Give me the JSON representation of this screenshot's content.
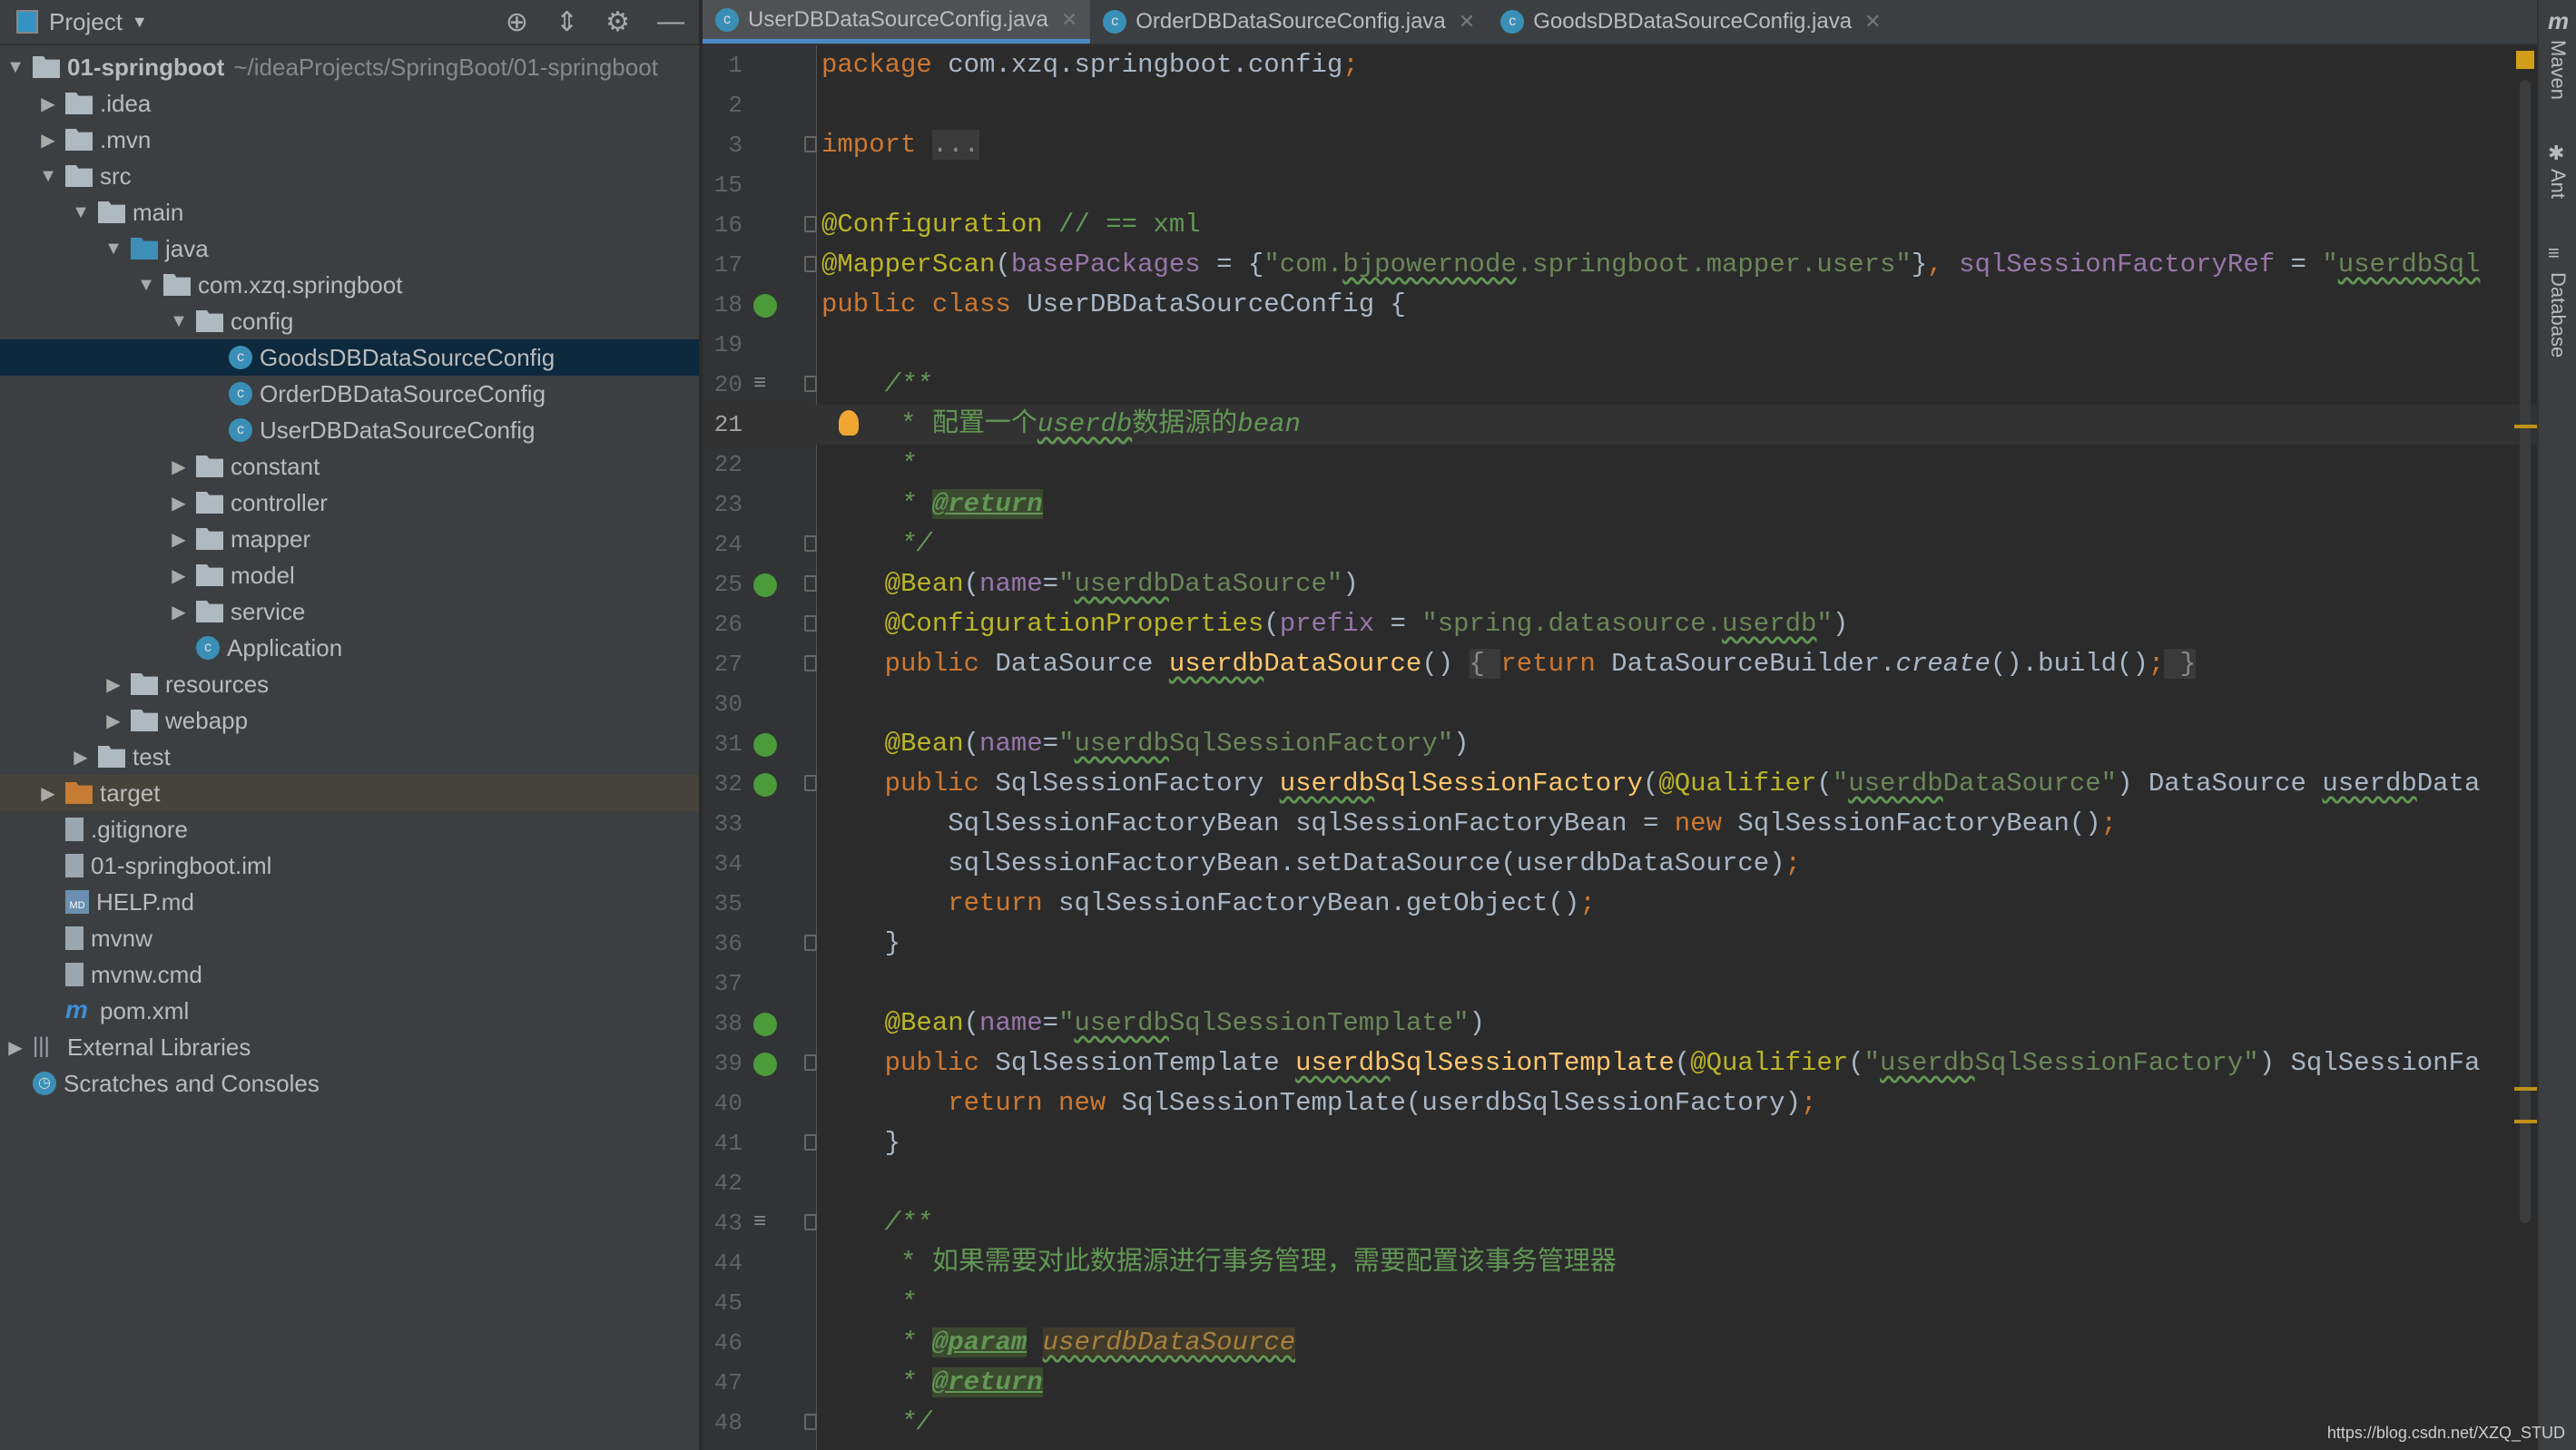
{
  "sidebar": {
    "title": "Project",
    "tree": [
      {
        "label": "01-springboot",
        "extra": "~/ideaProjects/SpringBoot/01-springboot",
        "depth": 0,
        "arrow": "down",
        "icon": "module-folder",
        "bold": true
      },
      {
        "label": ".idea",
        "depth": 1,
        "arrow": "right",
        "icon": "folder"
      },
      {
        "label": ".mvn",
        "depth": 1,
        "arrow": "right",
        "icon": "folder"
      },
      {
        "label": "src",
        "depth": 1,
        "arrow": "down",
        "icon": "folder"
      },
      {
        "label": "main",
        "depth": 2,
        "arrow": "down",
        "icon": "folder"
      },
      {
        "label": "java",
        "depth": 3,
        "arrow": "down",
        "icon": "source-folder"
      },
      {
        "label": "com.xzq.springboot",
        "depth": 4,
        "arrow": "down",
        "icon": "package"
      },
      {
        "label": "config",
        "depth": 5,
        "arrow": "down",
        "icon": "package"
      },
      {
        "label": "GoodsDBDataSourceConfig",
        "depth": 6,
        "icon": "class",
        "selected": true
      },
      {
        "label": "OrderDBDataSourceConfig",
        "depth": 6,
        "icon": "class"
      },
      {
        "label": "UserDBDataSourceConfig",
        "depth": 6,
        "icon": "class"
      },
      {
        "label": "constant",
        "depth": 5,
        "arrow": "right",
        "icon": "package"
      },
      {
        "label": "controller",
        "depth": 5,
        "arrow": "right",
        "icon": "package"
      },
      {
        "label": "mapper",
        "depth": 5,
        "arrow": "right",
        "icon": "package"
      },
      {
        "label": "model",
        "depth": 5,
        "arrow": "right",
        "icon": "package"
      },
      {
        "label": "service",
        "depth": 5,
        "arrow": "right",
        "icon": "package"
      },
      {
        "label": "Application",
        "depth": 5,
        "icon": "spring-class"
      },
      {
        "label": "resources",
        "depth": 3,
        "arrow": "right",
        "icon": "folder"
      },
      {
        "label": "webapp",
        "depth": 3,
        "arrow": "right",
        "icon": "folder"
      },
      {
        "label": "test",
        "depth": 2,
        "arrow": "right",
        "icon": "folder"
      },
      {
        "label": "target",
        "depth": 1,
        "arrow": "right",
        "icon": "excluded-folder",
        "highlighted": true
      },
      {
        "label": ".gitignore",
        "depth": 1,
        "icon": "file"
      },
      {
        "label": "01-springboot.iml",
        "depth": 1,
        "icon": "file"
      },
      {
        "label": "HELP.md",
        "depth": 1,
        "icon": "markdown"
      },
      {
        "label": "mvnw",
        "depth": 1,
        "icon": "file"
      },
      {
        "label": "mvnw.cmd",
        "depth": 1,
        "icon": "file"
      },
      {
        "label": "pom.xml",
        "depth": 1,
        "icon": "maven"
      },
      {
        "label": "External Libraries",
        "depth": 0,
        "arrow": "right",
        "icon": "library"
      },
      {
        "label": "Scratches and Consoles",
        "depth": 0,
        "icon": "scratches"
      }
    ]
  },
  "tabs": [
    {
      "label": "UserDBDataSourceConfig.java",
      "active": true
    },
    {
      "label": "OrderDBDataSourceConfig.java"
    },
    {
      "label": "GoodsDBDataSourceConfig.java"
    }
  ],
  "right_tools": [
    "Maven",
    "Ant",
    "Database"
  ],
  "watermark": "https://blog.csdn.net/XZQ_STUD",
  "editor": {
    "current_line": "21",
    "lines": [
      {
        "n": "1",
        "t": [
          [
            "package",
            "kw"
          ],
          [
            " com.xzq.springboot.config",
            ""
          ],
          [
            ";",
            "semi"
          ]
        ]
      },
      {
        "n": "2",
        "t": []
      },
      {
        "n": "3",
        "fold": true,
        "t": [
          [
            "import",
            "kw"
          ],
          [
            " ",
            ""
          ],
          [
            "...",
            "foldbox"
          ]
        ]
      },
      {
        "n": "15",
        "t": []
      },
      {
        "n": "16",
        "fold": true,
        "t": [
          [
            "@Configuration",
            "ann"
          ],
          [
            " // == xml",
            "cmtn"
          ]
        ]
      },
      {
        "n": "17",
        "fold": true,
        "t": [
          [
            "@MapperScan",
            "ann"
          ],
          [
            "(",
            ""
          ],
          [
            "basePackages",
            "fld"
          ],
          [
            " = {",
            ""
          ],
          [
            "\"com.",
            "str"
          ],
          [
            "bjpowernode",
            "str wav"
          ],
          [
            ".springboot.mapper.users\"",
            "str"
          ],
          [
            "}",
            ""
          ],
          [
            ", ",
            "semi"
          ],
          [
            "sqlSessionFactoryRef",
            "fld"
          ],
          [
            " = ",
            ""
          ],
          [
            "\"",
            "str"
          ],
          [
            "userdbSql",
            "str wav"
          ]
        ]
      },
      {
        "n": "18",
        "gi": "spring",
        "t": [
          [
            "public class",
            "kw"
          ],
          [
            " UserDBDataSourceConfig {",
            ""
          ]
        ]
      },
      {
        "n": "19",
        "t": []
      },
      {
        "n": "20",
        "gi": "summary",
        "fold": true,
        "t": [
          [
            "    /**",
            "cmt"
          ]
        ]
      },
      {
        "n": "21",
        "bulb": true,
        "t": [
          [
            "     * 配置一个",
            "cmtn"
          ],
          [
            "userdb",
            "cmt wav"
          ],
          [
            "数据源的",
            "cmtn"
          ],
          [
            "bean",
            "cmt"
          ]
        ]
      },
      {
        "n": "22",
        "t": [
          [
            "     *",
            "cmt"
          ]
        ]
      },
      {
        "n": "23",
        "t": [
          [
            "     * ",
            "cmt"
          ],
          [
            "@return",
            "tag"
          ]
        ]
      },
      {
        "n": "24",
        "fold": true,
        "t": [
          [
            "     */",
            "cmt"
          ]
        ]
      },
      {
        "n": "25",
        "gi": "spring",
        "fold": true,
        "t": [
          [
            "    @Bean",
            "ann"
          ],
          [
            "(",
            ""
          ],
          [
            "name",
            "fld"
          ],
          [
            "=",
            ""
          ],
          [
            "\"",
            "str"
          ],
          [
            "userdb",
            "str wav"
          ],
          [
            "DataSource\"",
            "str"
          ],
          [
            ")",
            ""
          ]
        ]
      },
      {
        "n": "26",
        "fold": true,
        "t": [
          [
            "    @ConfigurationProperties",
            "ann"
          ],
          [
            "(",
            ""
          ],
          [
            "prefix",
            "fld"
          ],
          [
            " = ",
            ""
          ],
          [
            "\"spring.datasource.",
            "str"
          ],
          [
            "userdb",
            "str wav"
          ],
          [
            "\"",
            "str"
          ],
          [
            ")",
            ""
          ]
        ]
      },
      {
        "n": "27",
        "fold": true,
        "t": [
          [
            "    public",
            "kw"
          ],
          [
            " DataSource ",
            ""
          ],
          [
            "userdb",
            "md wav"
          ],
          [
            "DataSource",
            "md"
          ],
          [
            "() ",
            ""
          ],
          [
            "{ ",
            "foldbox"
          ],
          [
            "return",
            "kw"
          ],
          [
            " DataSourceBuilder.",
            ""
          ],
          [
            "create",
            "it"
          ],
          [
            "().build()",
            ""
          ],
          [
            ";",
            "semi"
          ],
          [
            " }",
            "foldbox"
          ]
        ]
      },
      {
        "n": "30",
        "t": []
      },
      {
        "n": "31",
        "gi": "spring",
        "t": [
          [
            "    @Bean",
            "ann"
          ],
          [
            "(",
            ""
          ],
          [
            "name",
            "fld"
          ],
          [
            "=",
            ""
          ],
          [
            "\"",
            "str"
          ],
          [
            "userdb",
            "str wav"
          ],
          [
            "SqlSessionFactory\"",
            "str"
          ],
          [
            ")",
            ""
          ]
        ]
      },
      {
        "n": "32",
        "gi": "spring",
        "fold": true,
        "t": [
          [
            "    public",
            "kw"
          ],
          [
            " SqlSessionFactory ",
            ""
          ],
          [
            "userdb",
            "md wav"
          ],
          [
            "SqlSessionFactory",
            "md"
          ],
          [
            "(",
            ""
          ],
          [
            "@Qualifier",
            "ann"
          ],
          [
            "(",
            ""
          ],
          [
            "\"",
            "str"
          ],
          [
            "userdb",
            "str wav"
          ],
          [
            "DataSource\"",
            "str"
          ],
          [
            ") DataSource ",
            ""
          ],
          [
            "userdb",
            "wav"
          ],
          [
            "Data",
            ""
          ]
        ]
      },
      {
        "n": "33",
        "t": [
          [
            "        SqlSessionFactoryBean sqlSessionFactoryBean = ",
            ""
          ],
          [
            "new",
            "kw"
          ],
          [
            " SqlSessionFactoryBean()",
            ""
          ],
          [
            ";",
            "semi"
          ]
        ]
      },
      {
        "n": "34",
        "t": [
          [
            "        sqlSessionFactoryBean.setDataSource(userdbDataSource)",
            ""
          ],
          [
            ";",
            "semi"
          ]
        ]
      },
      {
        "n": "35",
        "t": [
          [
            "        return",
            "kw"
          ],
          [
            " sqlSessionFactoryBean.getObject()",
            ""
          ],
          [
            ";",
            "semi"
          ]
        ]
      },
      {
        "n": "36",
        "fold": true,
        "t": [
          [
            "    }",
            ""
          ]
        ]
      },
      {
        "n": "37",
        "t": []
      },
      {
        "n": "38",
        "gi": "spring",
        "t": [
          [
            "    @Bean",
            "ann"
          ],
          [
            "(",
            ""
          ],
          [
            "name",
            "fld"
          ],
          [
            "=",
            ""
          ],
          [
            "\"",
            "str"
          ],
          [
            "userdb",
            "str wav"
          ],
          [
            "SqlSessionTemplate\"",
            "str"
          ],
          [
            ")",
            ""
          ]
        ]
      },
      {
        "n": "39",
        "gi": "spring",
        "fold": true,
        "t": [
          [
            "    public",
            "kw"
          ],
          [
            " SqlSessionTemplate ",
            ""
          ],
          [
            "userdb",
            "md wav"
          ],
          [
            "SqlSessionTemplate",
            "md"
          ],
          [
            "(",
            ""
          ],
          [
            "@Qualifier",
            "ann"
          ],
          [
            "(",
            ""
          ],
          [
            "\"",
            "str"
          ],
          [
            "userdb",
            "str wav"
          ],
          [
            "SqlSessionFactory\"",
            "str"
          ],
          [
            ") SqlSessionFa",
            ""
          ]
        ]
      },
      {
        "n": "40",
        "t": [
          [
            "        return new",
            "kw"
          ],
          [
            " SqlSessionTemplate(userdbSqlSessionFactory)",
            ""
          ],
          [
            ";",
            "semi"
          ]
        ]
      },
      {
        "n": "41",
        "fold": true,
        "t": [
          [
            "    }",
            ""
          ]
        ]
      },
      {
        "n": "42",
        "t": []
      },
      {
        "n": "43",
        "gi": "summary",
        "fold": true,
        "t": [
          [
            "    /**",
            "cmt"
          ]
        ]
      },
      {
        "n": "44",
        "t": [
          [
            "     * 如果需要对此数据源进行事务管理，需要配置该事务管理器",
            "cmtn"
          ]
        ]
      },
      {
        "n": "45",
        "t": [
          [
            "     *",
            "cmt"
          ]
        ]
      },
      {
        "n": "46",
        "t": [
          [
            "     * ",
            "cmt"
          ],
          [
            "@param",
            "tag"
          ],
          [
            " ",
            ""
          ],
          [
            "userdbDataSource",
            "prm wav"
          ]
        ]
      },
      {
        "n": "47",
        "t": [
          [
            "     * ",
            "cmt"
          ],
          [
            "@return",
            "tag"
          ]
        ]
      },
      {
        "n": "48",
        "fold": true,
        "t": [
          [
            "     */",
            "cmt"
          ]
        ]
      }
    ]
  }
}
